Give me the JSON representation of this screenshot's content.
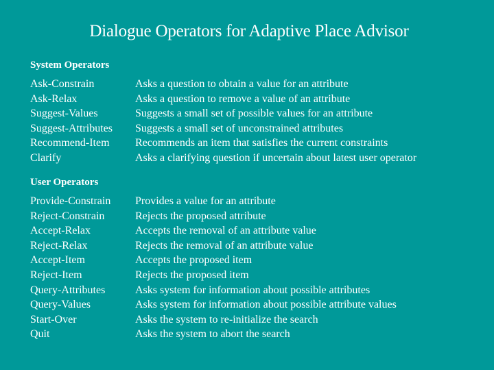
{
  "title": "Dialogue Operators for Adaptive Place Advisor",
  "sections": [
    {
      "heading": "System Operators",
      "rows": [
        {
          "operator": "Ask-Constrain",
          "description": "Asks a question to obtain a value for an attribute"
        },
        {
          "operator": "Ask-Relax",
          "description": "Asks a question to remove a value of an attribute"
        },
        {
          "operator": "Suggest-Values",
          "description": "Suggests a small set of  possible values for an attribute"
        },
        {
          "operator": "Suggest-Attributes",
          "description": "Suggests a small set of unconstrained attributes"
        },
        {
          "operator": "Recommend-Item",
          "description": "Recommends an item that satisfies the current constraints"
        },
        {
          "operator": "Clarify",
          "description": "Asks a clarifying question if uncertain about latest user operator"
        }
      ]
    },
    {
      "heading": "User Operators",
      "rows": [
        {
          "operator": "Provide-Constrain",
          "description": "Provides a value for an attribute"
        },
        {
          "operator": "Reject-Constrain",
          "description": "Rejects the proposed attribute"
        },
        {
          "operator": "Accept-Relax",
          "description": "Accepts the removal of an attribute value"
        },
        {
          "operator": "Reject-Relax",
          "description": "Rejects the removal of an attribute value"
        },
        {
          "operator": "Accept-Item",
          "description": "Accepts the proposed item"
        },
        {
          "operator": "Reject-Item",
          "description": "Rejects the proposed item"
        },
        {
          "operator": "Query-Attributes",
          "description": "Asks system for information about possible attributes"
        },
        {
          "operator": "Query-Values",
          "description": "Asks system for information about possible attribute values"
        },
        {
          "operator": "Start-Over",
          "description": "Asks the system to re-initialize the search"
        },
        {
          "operator": "Quit",
          "description": "Asks the system to abort the search"
        }
      ]
    }
  ]
}
